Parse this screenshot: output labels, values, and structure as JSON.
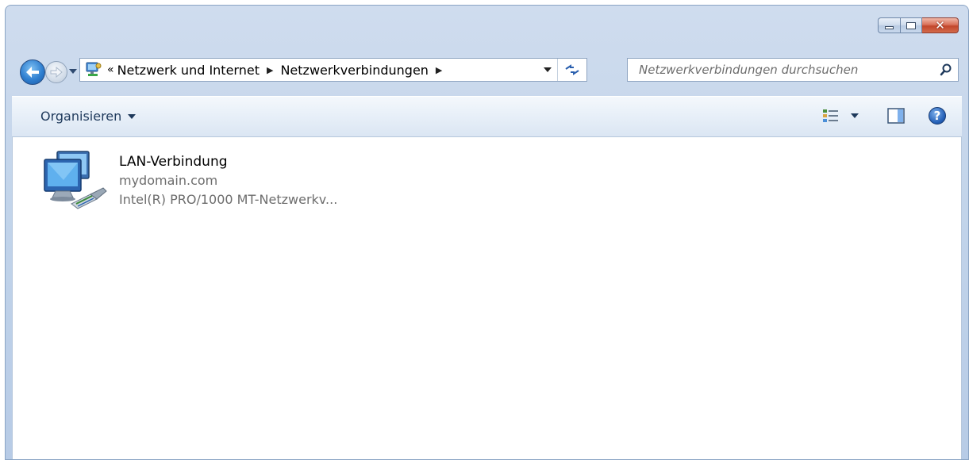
{
  "window": {
    "caption_buttons": {
      "minimize": "minimize",
      "maximize": "maximize",
      "close": "close"
    }
  },
  "navigation": {
    "address": {
      "overflow": "«",
      "segments": [
        "Netzwerk und Internet",
        "Netzwerkverbindungen"
      ]
    },
    "search": {
      "placeholder": "Netzwerkverbindungen durchsuchen"
    }
  },
  "toolbar": {
    "organize_label": "Organisieren"
  },
  "items": [
    {
      "name": "LAN-Verbindung",
      "status": "mydomain.com",
      "device": "Intel(R) PRO/1000 MT-Netzwerkv..."
    }
  ],
  "colors": {
    "accent": "#2f7fd0",
    "chrome": "#c2d4ea",
    "close": "#c2462b"
  }
}
